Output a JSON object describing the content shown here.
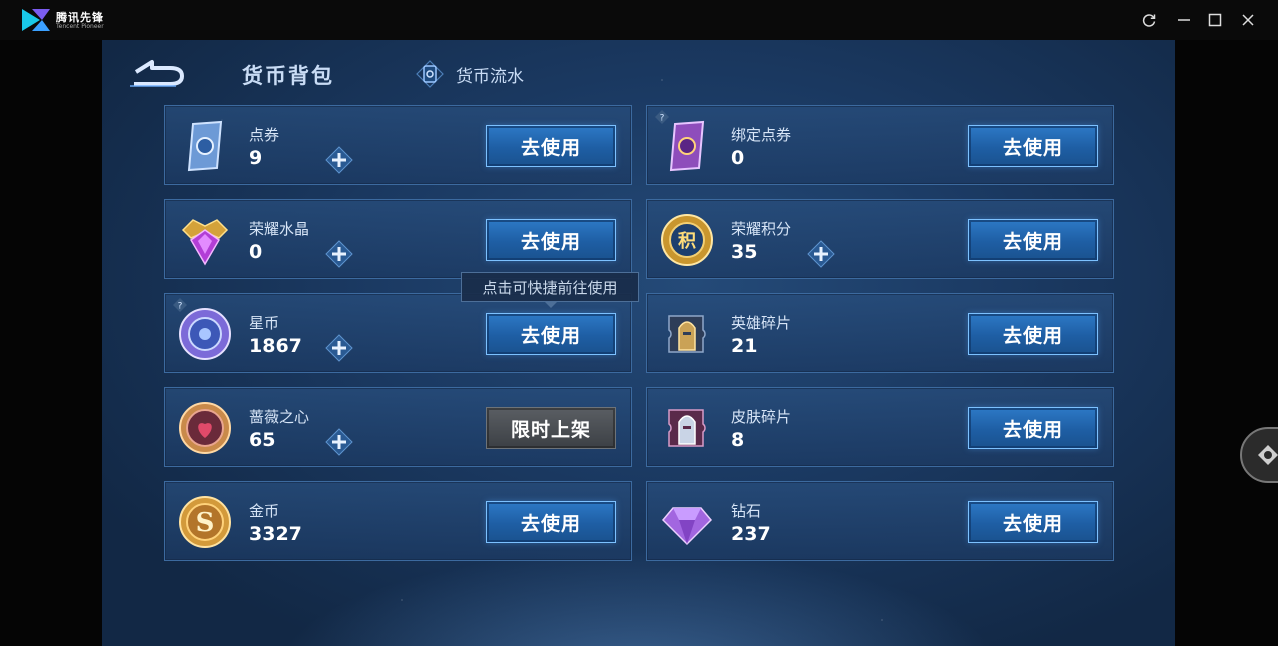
{
  "emulator": {
    "app_name": "腾讯先锋",
    "app_subtitle": "Tencent Pioneer",
    "controls": [
      "refresh-icon",
      "minimize-icon",
      "maximize-icon",
      "close-icon"
    ]
  },
  "header": {
    "title": "货币背包",
    "flow_link": "货币流水"
  },
  "tooltip": "点击可快捷前往使用",
  "currencies": [
    {
      "name": "点券",
      "amount": "9",
      "button": "去使用",
      "icon": "coupon-icon",
      "has_plus": true,
      "has_help": false
    },
    {
      "name": "绑定点券",
      "amount": "0",
      "button": "去使用",
      "icon": "bound-coupon-icon",
      "has_plus": false,
      "has_help": true
    },
    {
      "name": "荣耀水晶",
      "amount": "0",
      "button": "去使用",
      "icon": "glory-crystal-icon",
      "has_plus": true,
      "has_help": false
    },
    {
      "name": "荣耀积分",
      "amount": "35",
      "button": "去使用",
      "icon": "glory-points-icon",
      "has_plus": true,
      "has_help": false
    },
    {
      "name": "星币",
      "amount": "1867",
      "button": "去使用",
      "icon": "star-coin-icon",
      "has_plus": true,
      "has_help": true
    },
    {
      "name": "英雄碎片",
      "amount": "21",
      "button": "去使用",
      "icon": "hero-fragment-icon",
      "has_plus": false,
      "has_help": false
    },
    {
      "name": "蔷薇之心",
      "amount": "65",
      "button": "限时上架",
      "icon": "rose-heart-icon",
      "has_plus": true,
      "has_help": false
    },
    {
      "name": "皮肤碎片",
      "amount": "8",
      "button": "去使用",
      "icon": "skin-fragment-icon",
      "has_plus": false,
      "has_help": false
    },
    {
      "name": "金币",
      "amount": "3327",
      "button": "去使用",
      "icon": "gold-coin-icon",
      "has_plus": false,
      "has_help": false
    },
    {
      "name": "钻石",
      "amount": "237",
      "button": "去使用",
      "icon": "diamond-icon",
      "has_plus": false,
      "has_help": false
    }
  ],
  "colors": {
    "button_blue": "#2d79c6",
    "button_border": "#7cc1ff",
    "card_border": "#3c6a9f",
    "background": "#1b3a63"
  }
}
